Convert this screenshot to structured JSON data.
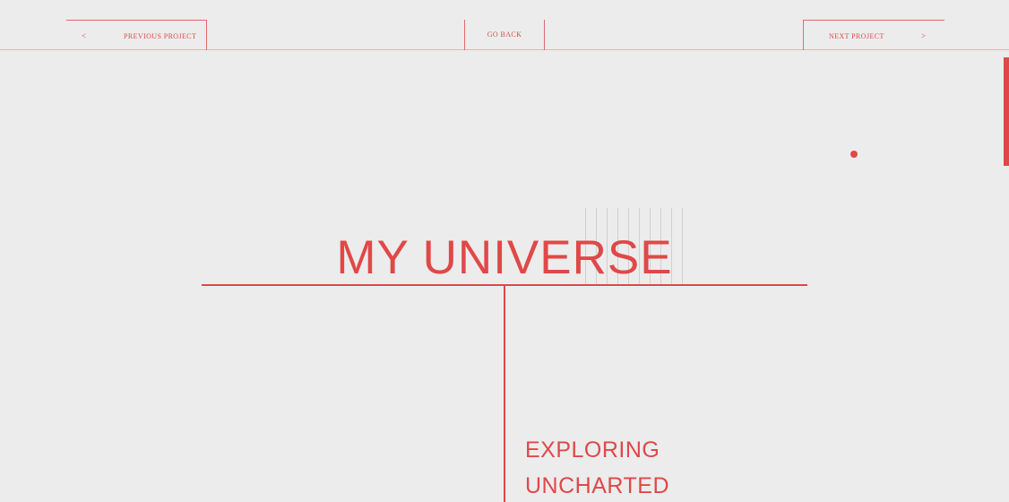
{
  "nav": {
    "prev_arrow": "<",
    "prev_label": "PREVIOUS PROJECT",
    "back_label": "GO BACK",
    "next_label": "NEXT PROJECT",
    "next_arrow": ">"
  },
  "hero": {
    "title": "MY UNIVERSE",
    "subtitle_lines": [
      "EXPLORING",
      "UNCHARTED"
    ]
  },
  "colors": {
    "accent": "#e04848",
    "background": "#ececec"
  }
}
